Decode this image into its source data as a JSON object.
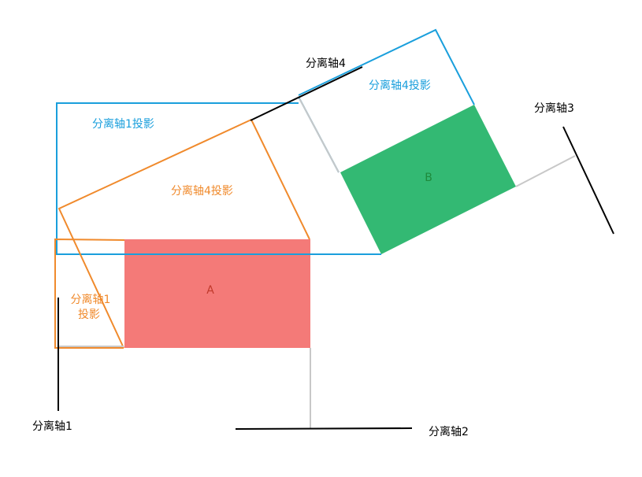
{
  "colors": {
    "shape_a": "#f47a78",
    "shape_b": "#33b973",
    "blue": "#1a9fdc",
    "orange": "#f08a2c",
    "axis": "#000000",
    "guide": "#c8c8c8"
  },
  "labels": {
    "shape_a": "A",
    "shape_b": "B",
    "axis1": "分离轴1",
    "axis2": "分离轴2",
    "axis3": "分离轴3",
    "axis4": "分离轴4",
    "blue_proj_axis1": "分离轴1投影",
    "blue_proj_axis4": "分离轴4投影",
    "orange_proj_axis4": "分离轴4投影",
    "orange_proj_axis1_line1": "分离轴1",
    "orange_proj_axis1_line2": "投影"
  }
}
